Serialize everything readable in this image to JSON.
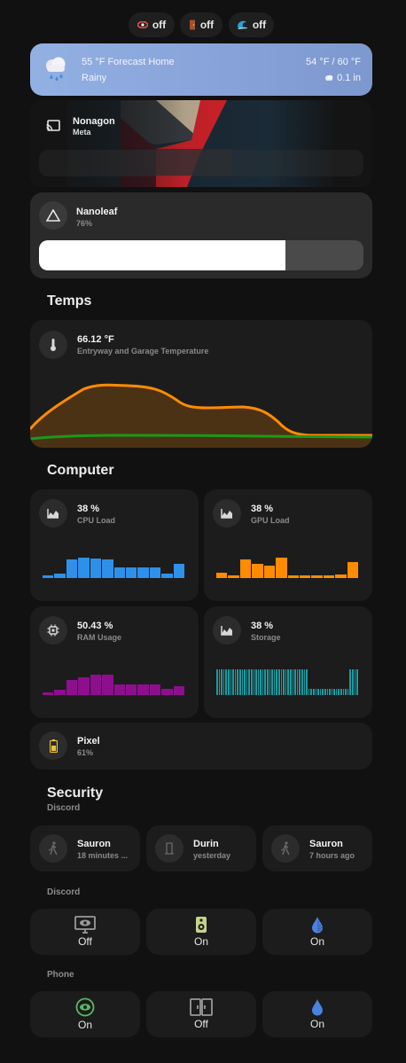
{
  "chips": [
    {
      "icon": "eye-icon",
      "state": "off",
      "color": "#e05050"
    },
    {
      "icon": "door-icon",
      "state": "off",
      "color": "#a0522d"
    },
    {
      "icon": "water-icon",
      "state": "off",
      "color": "#2aa0d8"
    }
  ],
  "weather": {
    "title": "55 °F Forecast Home",
    "condition": "Rainy",
    "temp_range": "54 °F / 60 °F",
    "precip": "0.1 in",
    "icon": "rainy-cloud-icon"
  },
  "media": {
    "title": "Nonagon",
    "artist": "Meta",
    "icon": "cast-icon"
  },
  "nanoleaf": {
    "name": "Nanoleaf",
    "level_text": "76%",
    "level": 0.76,
    "icon": "triangle-icon"
  },
  "temps": {
    "section": "Temps",
    "value": "66.12 °F",
    "name": "Entryway and Garage Temperature",
    "icon": "thermometer-icon",
    "series_colors": [
      "#ff8c00",
      "#1a9a1a"
    ]
  },
  "computer": {
    "section": "Computer",
    "sensors": [
      {
        "value": "38 %",
        "name": "CPU Load",
        "icon": "chart-icon",
        "color": "#2f90ea",
        "history": [
          0.1,
          0.15,
          0.65,
          0.72,
          0.7,
          0.65,
          0.38,
          0.38,
          0.38,
          0.38,
          0.15,
          0.5
        ]
      },
      {
        "value": "38 %",
        "name": "GPU Load",
        "icon": "chart-icon",
        "color": "#ff8c00",
        "history": [
          0.2,
          0.1,
          0.65,
          0.5,
          0.45,
          0.72,
          0.08,
          0.08,
          0.08,
          0.08,
          0.12,
          0.55
        ]
      },
      {
        "value": "50.43 %",
        "name": "RAM Usage",
        "icon": "chip-icon",
        "color": "#8e0f8e",
        "history": [
          0.08,
          0.2,
          0.52,
          0.62,
          0.72,
          0.72,
          0.38,
          0.38,
          0.38,
          0.38,
          0.22,
          0.3
        ]
      },
      {
        "value": "38 %",
        "name": "Storage",
        "icon": "chart-icon",
        "color": "#1a9aa0",
        "history_high": 0.52,
        "history_low": 0.12
      }
    ]
  },
  "battery": {
    "name": "Pixel",
    "level_text": "61%",
    "icon": "battery-icon",
    "color": "#e8c23a"
  },
  "security": {
    "section": "Security",
    "subtitle": "Discord",
    "tiles": [
      {
        "name": "Sauron",
        "when": "18 minutes ...",
        "icon": "walk-icon"
      },
      {
        "name": "Durin",
        "when": "yesterday",
        "icon": "door-closed-icon"
      },
      {
        "name": "Sauron",
        "when": "7 hours ago",
        "icon": "walk-icon"
      }
    ]
  },
  "discord_buttons": {
    "title": "Discord",
    "buttons": [
      {
        "label": "Off",
        "icon": "monitor-eye-icon",
        "color": "#9a9a9a"
      },
      {
        "label": "On",
        "icon": "speaker-icon",
        "color": "#c4d48a"
      },
      {
        "label": "On",
        "icon": "water-drop-icon",
        "color": "#4a82e0"
      }
    ]
  },
  "phone_buttons": {
    "title": "Phone",
    "buttons": [
      {
        "label": "On",
        "icon": "eye-circle-icon",
        "color": "#5ab864"
      },
      {
        "label": "Off",
        "icon": "wardrobe-icon",
        "color": "#9a9a9a"
      },
      {
        "label": "On",
        "icon": "water-drop-icon",
        "color": "#4a82e0"
      }
    ]
  }
}
